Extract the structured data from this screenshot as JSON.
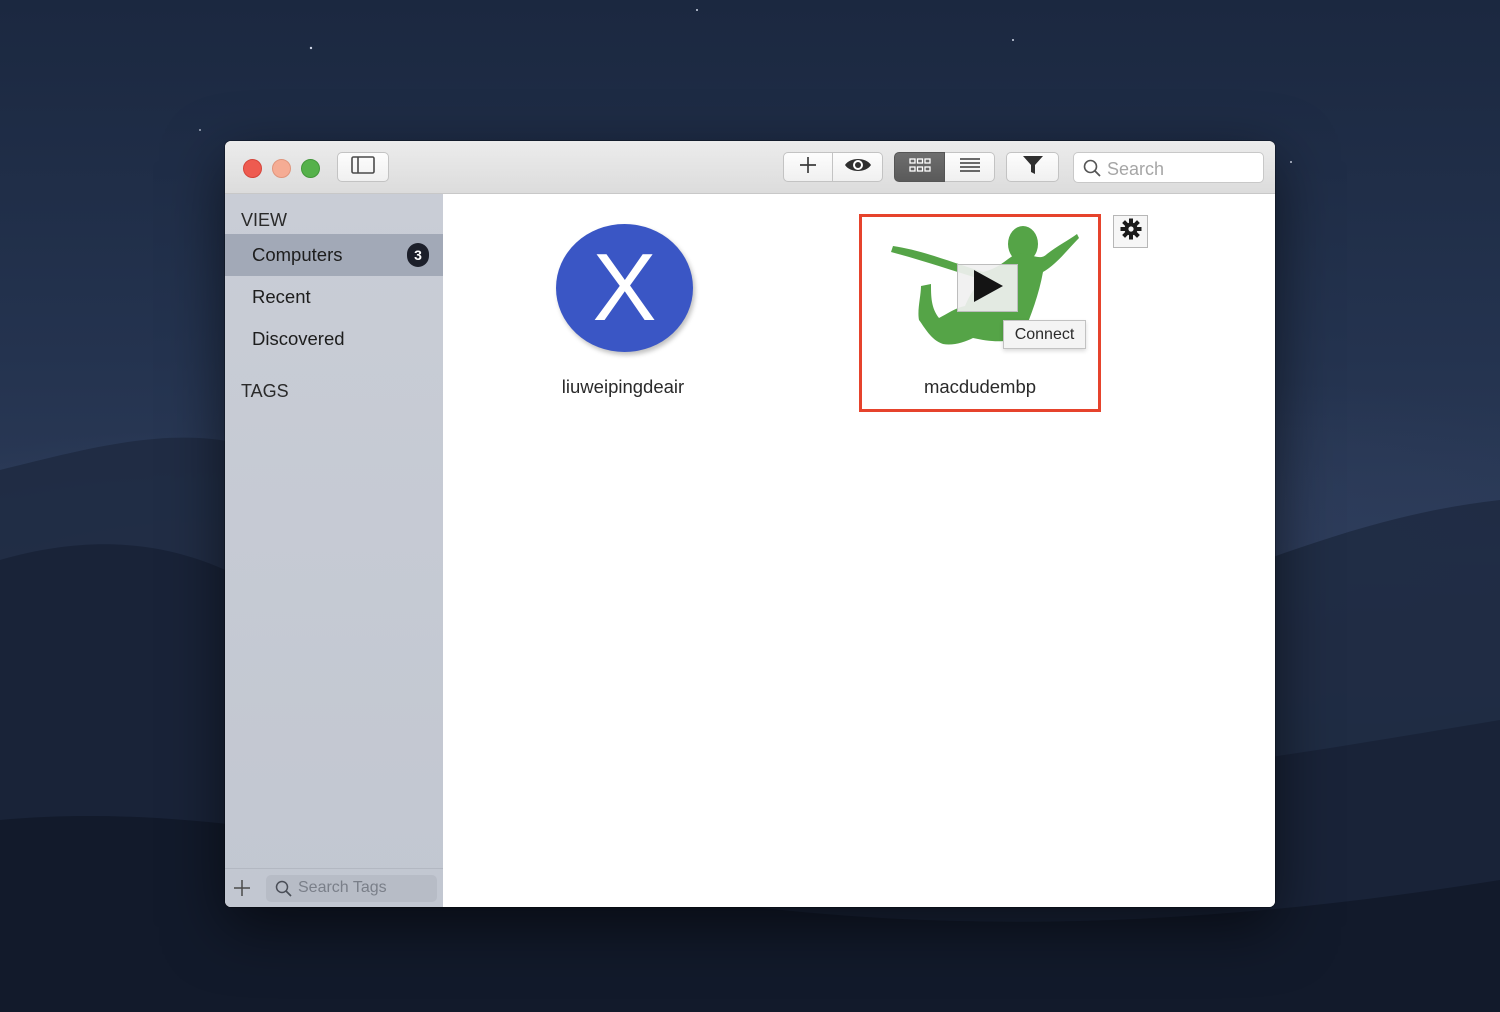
{
  "toolbar": {
    "sidebar_toggle_icon": "sidebar-toggle-icon",
    "add_icon": "plus-icon",
    "preview_icon": "eye-icon",
    "grid_view_icon": "grid-icon",
    "list_view_icon": "list-icon",
    "filter_icon": "funnel-icon",
    "search": {
      "placeholder": "Search",
      "icon": "search-icon"
    }
  },
  "sidebar": {
    "view_header": "VIEW",
    "items": [
      {
        "label": "Computers",
        "badge": "3",
        "selected": true
      },
      {
        "label": "Recent",
        "selected": false
      },
      {
        "label": "Discovered",
        "selected": false
      }
    ],
    "tags_header": "TAGS",
    "footer": {
      "add_icon": "plus-icon",
      "tag_search_placeholder": "Search Tags"
    }
  },
  "computers": [
    {
      "name": "liuweipingdeair",
      "icon": "macos-x-icon",
      "icon_glyph": "X",
      "icon_color": "#3a56c5"
    },
    {
      "name": "macdudembp",
      "icon": "green-figure-icon",
      "icon_color": "#55a447",
      "selected": true,
      "overlay_icon": "play-icon",
      "tooltip": "Connect",
      "settings_icon": "gear-icon"
    }
  ],
  "colors": {
    "highlight": "#e6432c",
    "badge": "#1c1f2a",
    "selected_sidebar": "#a2a9b7"
  }
}
